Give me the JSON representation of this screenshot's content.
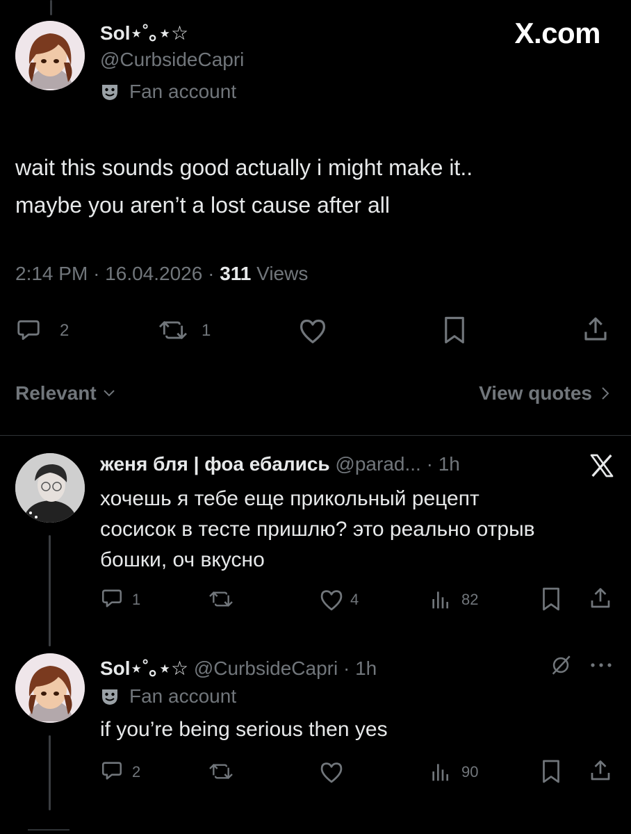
{
  "watermark": "X.com",
  "main_tweet": {
    "display_name": "Sol⋆˚｡⋆☆",
    "handle": "@CurbsideCapri",
    "badge": "Fan account",
    "text_line1": "wait this sounds good actually i might make it..",
    "text_line2": "maybe you aren’t a lost cause after all",
    "time": "2:14 PM",
    "date": "16.04.2026",
    "views_count": "311",
    "views_label": "Views",
    "sep": "·",
    "replies": "2",
    "reposts": "1"
  },
  "sort": {
    "label": "Relevant",
    "quotes_link": "View quotes"
  },
  "reply1": {
    "display_name": "женя бля | фоа ебались",
    "handle": "@parad...",
    "time": "1h",
    "sep": "·",
    "text_line1": "хочешь я тебе еще прикольный рецепт",
    "text_line2": "сосисок в тесте пришлю? это реально отрыв",
    "text_line3": "бошки, оч вкусно",
    "replies": "1",
    "likes": "4",
    "views": "82"
  },
  "reply2": {
    "display_name": "Sol⋆˚｡⋆☆",
    "handle": "@CurbsideCapri",
    "time": "1h",
    "sep": "·",
    "badge": "Fan account",
    "text": "if you’re being serious then yes",
    "replies": "2",
    "views": "90"
  },
  "colors": {
    "background": "#000000",
    "text": "#e7e9ea",
    "muted": "#71767b",
    "thread_line": "#3a3d41"
  }
}
